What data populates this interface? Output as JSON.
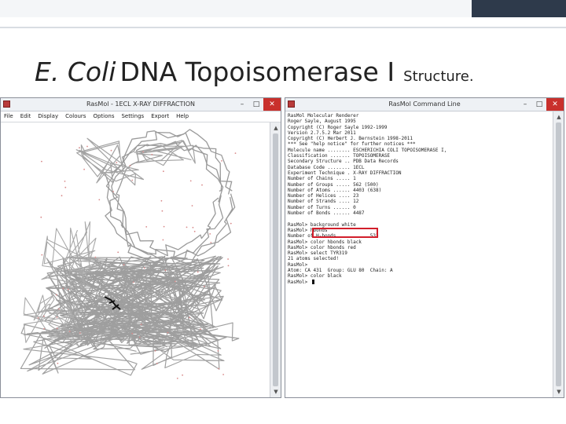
{
  "slide": {
    "title_italic": "E. Coli",
    "title_main": "DNA Topoisomerase I",
    "title_small": "Structure."
  },
  "graphics_window": {
    "title": "RasMol - 1ECL X-RAY DIFFRACTION",
    "menu": [
      "File",
      "Edit",
      "Display",
      "Colours",
      "Options",
      "Settings",
      "Export",
      "Help"
    ],
    "controls": {
      "minimize": "–",
      "maximize": "□",
      "close": "✕"
    },
    "canvas_label": "protein backbone rendering"
  },
  "command_window": {
    "title": "RasMol Command Line",
    "controls": {
      "minimize": "–",
      "maximize": "□",
      "close": "✕"
    },
    "lines": [
      "RasMol Molecular Renderer",
      "Roger Sayle, August 1995",
      "Copyright (C) Roger Sayle 1992-1999",
      "Version 2.7.5.2 Mar 2011",
      "Copyright (C) Herbert J. Bernstein 1998-2011",
      "*** See \"help notice\" for further notices ***",
      "Molecule name ........ ESCHERICHIA COLI TOPOISOMERASE I,",
      "Classification ....... TOPOISOMERASE",
      "Secondary Structure .. PDB Data Records",
      "Database Code ........ 1ECL",
      "Experiment Technique . X-RAY DIFFRACTION",
      "Number of Chains ..... 1",
      "Number of Groups ..... 562 (500)",
      "Number of Atoms ...... 4403 (638)",
      "Number of Helices .... 23",
      "Number of Strands .... 12",
      "Number of Turns ...... 0",
      "Number of Bonds ...... 4487",
      "",
      "RasMol> background white",
      "RasMol> hbonds",
      "Number of H-bonds .......... 533",
      "RasMol> color hbonds black",
      "RasMol> color hbonds red",
      "RasMol> select TYR319",
      "21 atoms selected!",
      "RasMol>",
      "Atom: CA 431  Group: GLU 80  Chain: A",
      "RasMol> color black",
      "RasMol> "
    ]
  }
}
